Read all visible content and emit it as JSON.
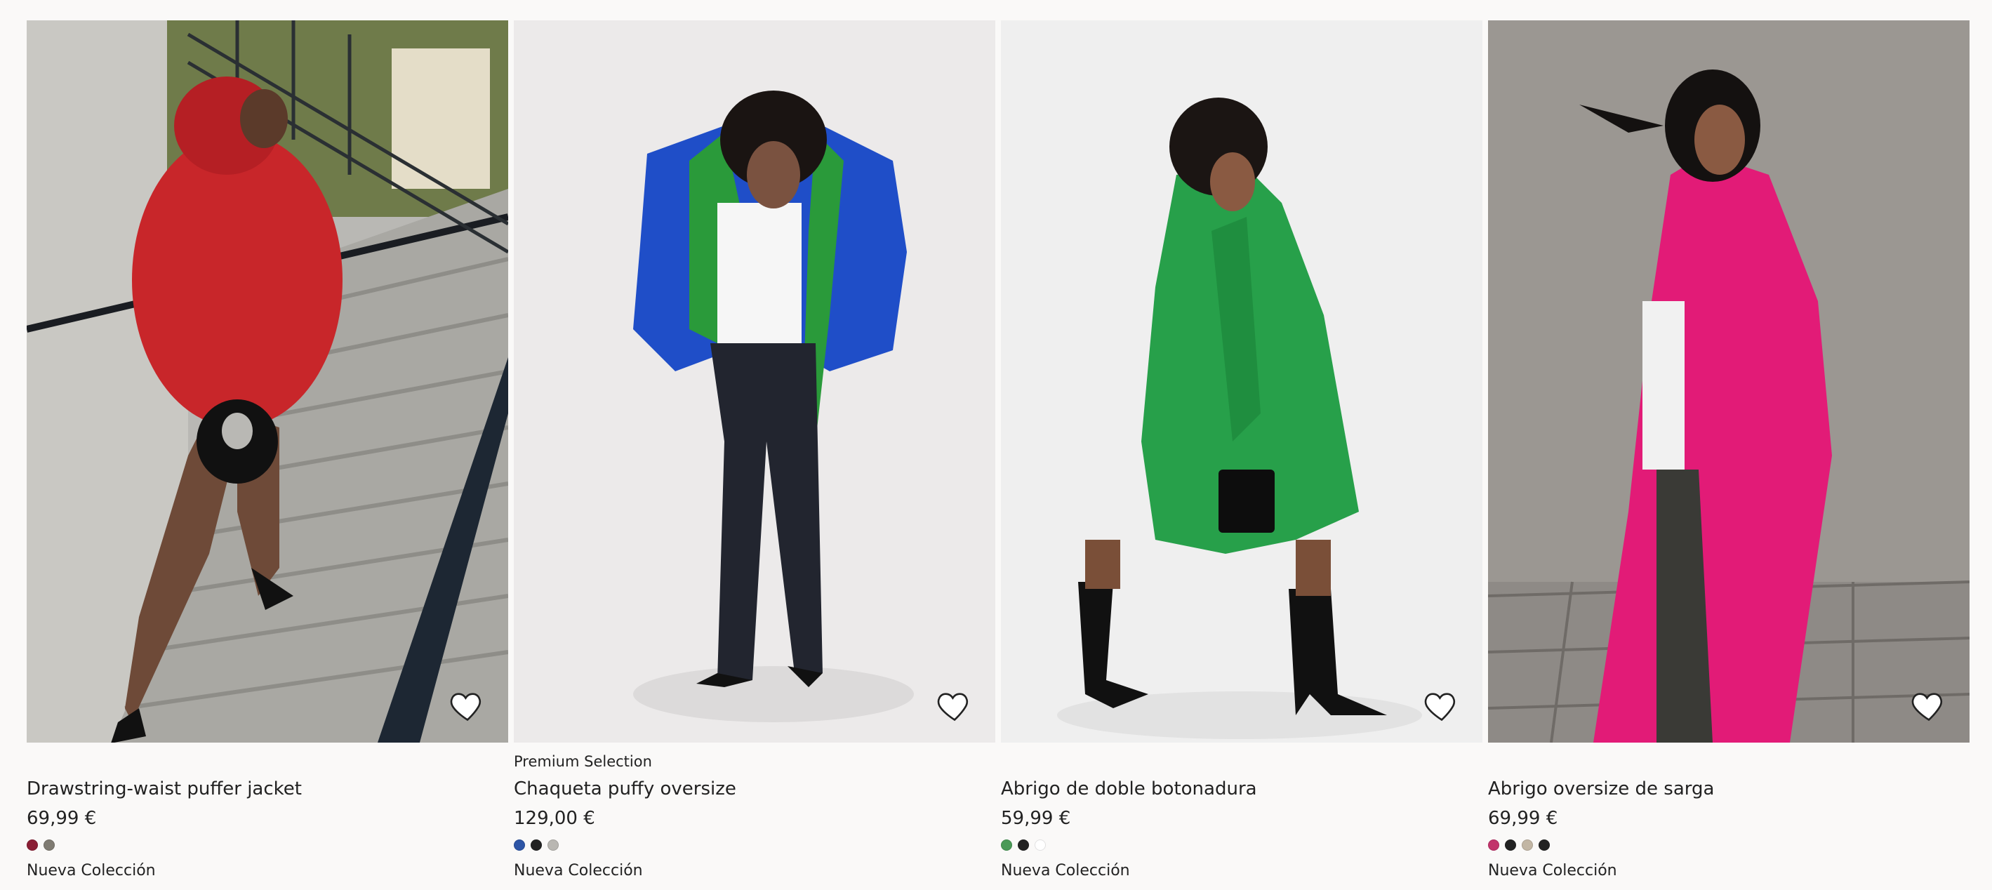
{
  "products": [
    {
      "meta": "",
      "title": "Drawstring-waist puffer jacket",
      "price": "69,99 €",
      "swatches": [
        "#8a1e34",
        "#7f7b72"
      ],
      "label": "Nueva Colección",
      "favorite_icon": "heart-outline-icon"
    },
    {
      "meta": "Premium Selection",
      "title": "Chaqueta puffy oversize",
      "price": "129,00 €",
      "swatches": [
        "#2d55a6",
        "#222222",
        "#b9b7b2"
      ],
      "label": "Nueva Colección",
      "favorite_icon": "heart-outline-icon"
    },
    {
      "meta": "",
      "title": "Abrigo de doble botonadura",
      "price": "59,99 €",
      "swatches": [
        "#4a9a57",
        "#222222",
        "#ffffff"
      ],
      "label": "Nueva Colección",
      "favorite_icon": "heart-outline-icon"
    },
    {
      "meta": "",
      "title": "Abrigo oversize de sarga",
      "price": "69,99 €",
      "swatches": [
        "#c2336b",
        "#222222",
        "#c2b6a4",
        "#222222"
      ],
      "label": "Nueva Colección",
      "favorite_icon": "heart-outline-icon"
    }
  ]
}
